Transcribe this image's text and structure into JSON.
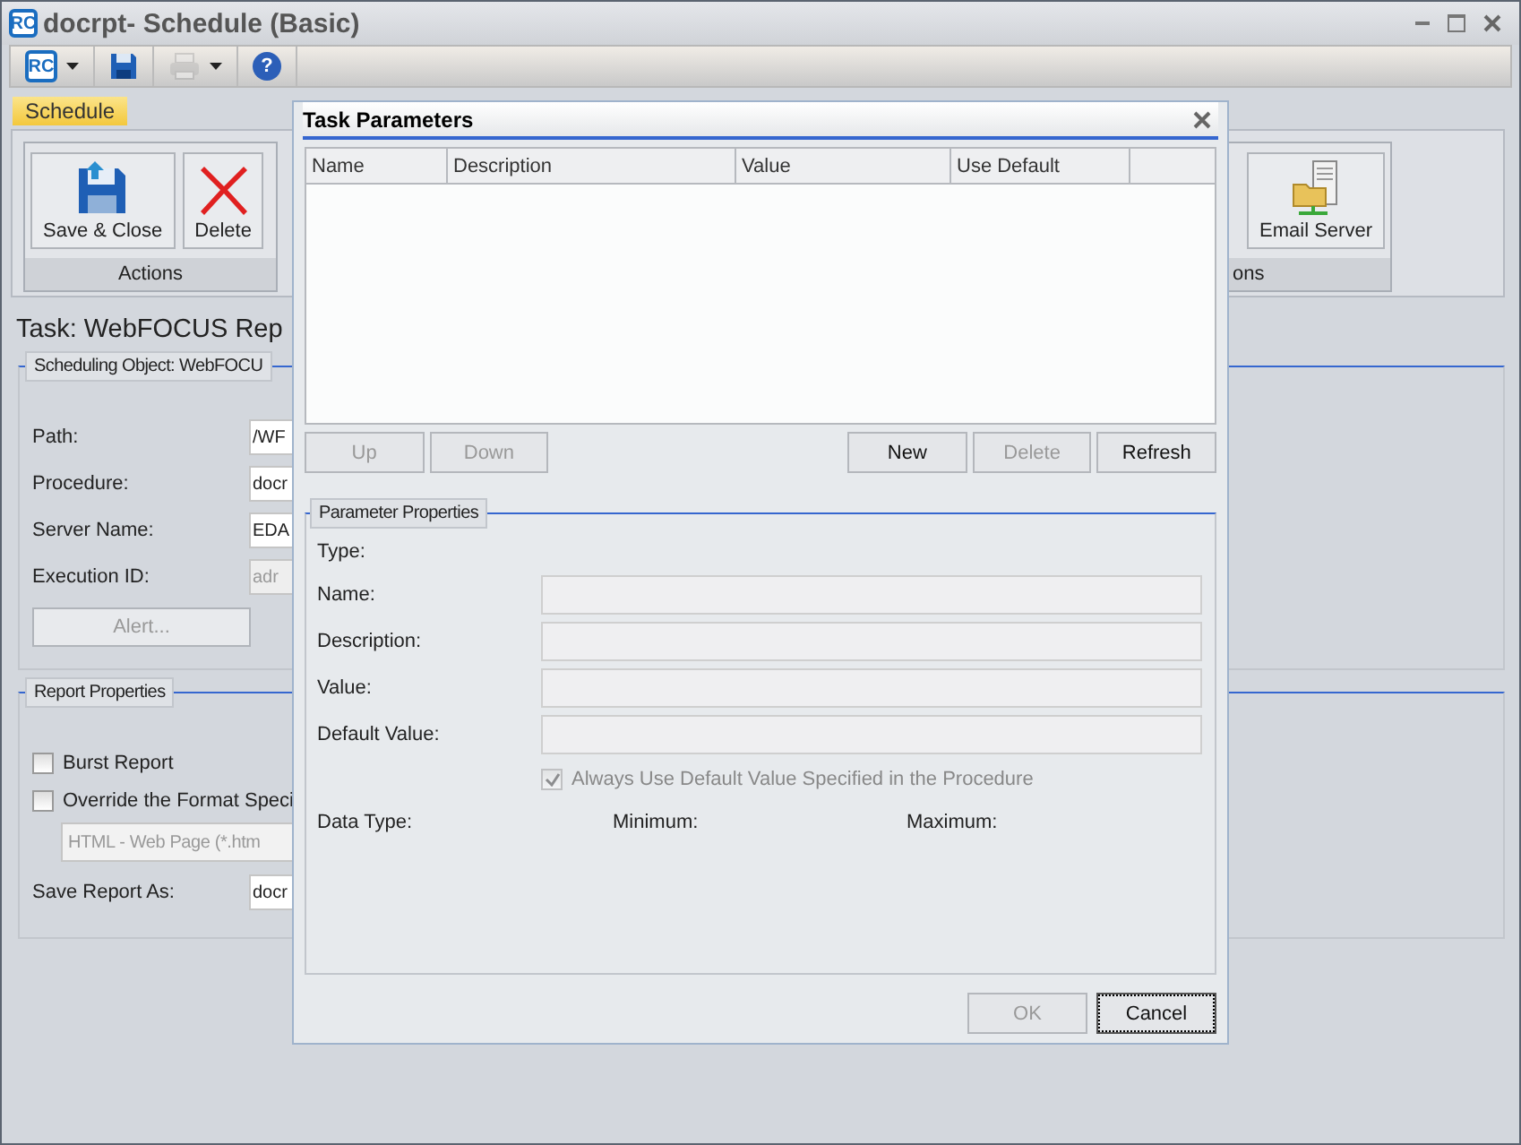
{
  "window": {
    "logo": "RC",
    "title": "docrpt- Schedule (Basic)"
  },
  "toolbar": [
    {
      "kind": "app",
      "label": "RC",
      "has_menu": true,
      "disabled": false
    },
    {
      "kind": "save",
      "has_menu": false,
      "disabled": false
    },
    {
      "kind": "print",
      "has_menu": true,
      "disabled": true
    },
    {
      "kind": "help",
      "label": "?",
      "has_menu": false,
      "disabled": false
    }
  ],
  "tabs": [
    {
      "label": "Schedule",
      "selected": true
    }
  ],
  "ribbon": {
    "groups": [
      {
        "label": "Actions",
        "buttons": [
          {
            "kind": "save",
            "label": "Save & Close"
          },
          {
            "kind": "delete",
            "label": "Delete"
          }
        ]
      },
      {
        "label": "ons",
        "buttons": [
          {
            "kind": "server",
            "label": "Email Server"
          }
        ]
      }
    ]
  },
  "task_heading": "Task: WebFOCUS Rep",
  "scheduling_object": {
    "legend": "Scheduling Object: WebFOCU",
    "fields": [
      {
        "label": "Path:",
        "value": "/WF",
        "disabled": false
      },
      {
        "label": "Procedure:",
        "value": "docr",
        "disabled": false
      },
      {
        "label": "Server Name:",
        "value": "EDA",
        "disabled": false
      },
      {
        "label": "Execution ID:",
        "value": "adr",
        "disabled": true
      }
    ],
    "alert_button": {
      "label": "Alert...",
      "disabled": true
    }
  },
  "report_properties": {
    "legend": "Report Properties",
    "options": [
      {
        "label": "Burst Report",
        "checked": false
      },
      {
        "label": "Override the Format Speci",
        "checked": false
      }
    ],
    "format": {
      "value": "HTML - Web Page (*.htm",
      "disabled": true
    },
    "save_as": {
      "label": "Save Report As:",
      "value": "docr"
    }
  },
  "dialog": {
    "title": "Task Parameters",
    "columns": [
      "Name",
      "Description",
      "Value",
      "Use Default"
    ],
    "list_buttons": [
      {
        "label": "Up",
        "disabled": true
      },
      {
        "label": "Down",
        "disabled": true
      },
      {
        "label": "New",
        "disabled": false
      },
      {
        "label": "Delete",
        "disabled": true
      },
      {
        "label": "Refresh",
        "disabled": false
      }
    ],
    "properties": {
      "legend": "Parameter Properties",
      "type_label": "Type:",
      "fields": [
        {
          "label": "Name:"
        },
        {
          "label": "Description:"
        },
        {
          "label": "Value:"
        },
        {
          "label": "Default Value:"
        }
      ],
      "always_default": {
        "label": "Always Use Default Value Specified in the Procedure",
        "checked": true,
        "disabled": true
      },
      "stats": [
        "Data Type:",
        "Minimum:",
        "Maximum:"
      ]
    },
    "buttons": [
      {
        "label": "OK",
        "disabled": true,
        "focused": false
      },
      {
        "label": "Cancel",
        "disabled": false,
        "focused": true
      }
    ]
  }
}
